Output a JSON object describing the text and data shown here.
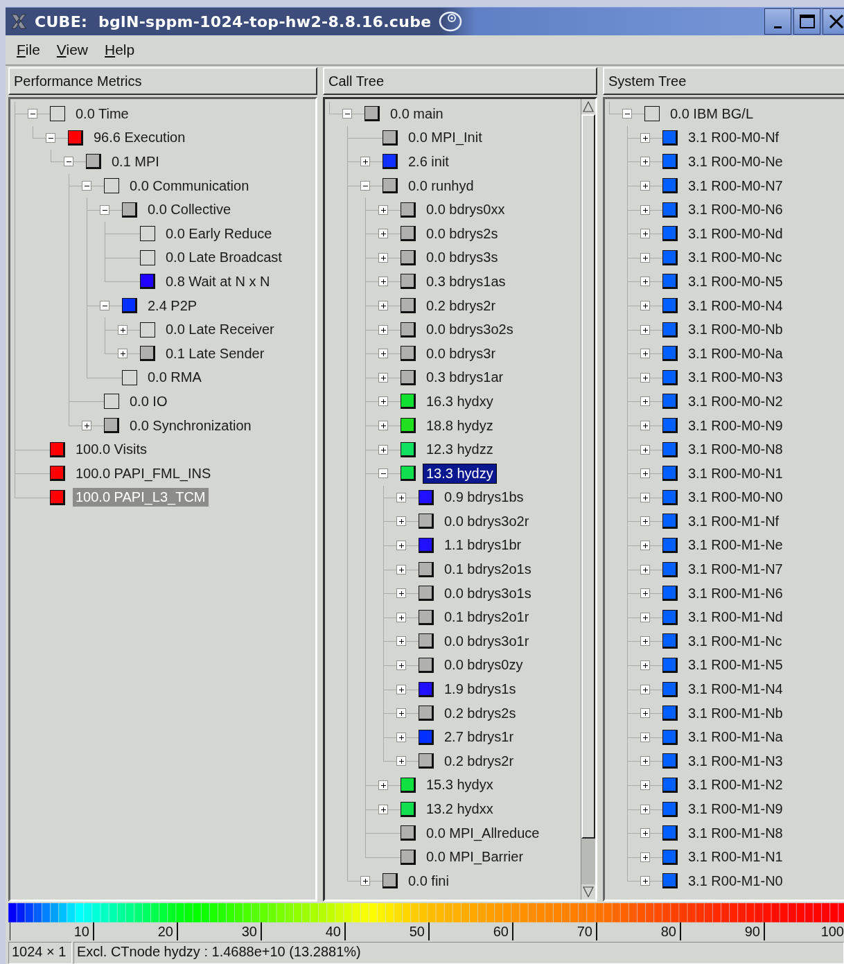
{
  "window": {
    "title": "CUBE:  bglN-sppm-1024-top-hw2-8.8.16.cube"
  },
  "menu": [
    {
      "label": "File"
    },
    {
      "label": "View"
    },
    {
      "label": "Help"
    }
  ],
  "panels": [
    {
      "title": "Performance Metrics",
      "focused": false,
      "tree": [
        {
          "label": "0.0 Time",
          "expanded": true,
          "selected": false,
          "children": [
            {
              "label": "96.6 Execution",
              "color": "#ff0000",
              "expanded": true,
              "selected": false,
              "children": [
                {
                  "label": "0.1 MPI",
                  "color": "#b0b0ae",
                  "expanded": true,
                  "selected": false,
                  "children": [
                    {
                      "label": "0.0 Communication",
                      "expanded": true,
                      "selected": false,
                      "children": [
                        {
                          "label": "0.0 Collective",
                          "color": "#b0b0ae",
                          "expanded": true,
                          "selected": false,
                          "children": [
                            {
                              "label": "0.0 Early Reduce",
                              "selected": false
                            },
                            {
                              "label": "0.0 Late Broadcast",
                              "selected": false
                            },
                            {
                              "label": "0.8 Wait at N x N",
                              "color": "#2000ff",
                              "selected": false
                            }
                          ]
                        },
                        {
                          "label": "2.4 P2P",
                          "color": "#0030ff",
                          "expanded": true,
                          "selected": false,
                          "children": [
                            {
                              "label": "0.0 Late Receiver",
                              "expanded": false,
                              "selected": false
                            },
                            {
                              "label": "0.1 Late Sender",
                              "color": "#b0b0ae",
                              "expanded": false,
                              "selected": false
                            }
                          ]
                        },
                        {
                          "label": "0.0 RMA",
                          "selected": false
                        }
                      ]
                    },
                    {
                      "label": "0.0 IO",
                      "selected": false
                    },
                    {
                      "label": "0.0 Synchronization",
                      "color": "#b0b0ae",
                      "expanded": false,
                      "selected": false
                    }
                  ]
                }
              ]
            }
          ]
        },
        {
          "label": "100.0 Visits",
          "color": "#ff0000",
          "selected": false
        },
        {
          "label": "100.0 PAPI_FML_INS",
          "color": "#ff0000",
          "selected": false
        },
        {
          "label": "100.0 PAPI_L3_TCM",
          "color": "#ff0000",
          "selected": true
        }
      ]
    },
    {
      "title": "Call Tree",
      "focused": true,
      "scrollable": true,
      "tree": [
        {
          "label": "0.0 main",
          "color": "#b0b0ae",
          "expanded": true,
          "selected": false,
          "children": [
            {
              "label": "0.0 MPI_Init",
              "color": "#b0b0ae",
              "selected": false
            },
            {
              "label": "2.6 init",
              "color": "#1030ff",
              "expanded": false,
              "selected": false
            },
            {
              "label": "0.0 runhyd",
              "color": "#b0b0ae",
              "expanded": true,
              "selected": false,
              "children": [
                {
                  "label": "0.0 bdrys0xx",
                  "color": "#b0b0ae",
                  "expanded": false,
                  "selected": false
                },
                {
                  "label": "0.0 bdrys2s",
                  "color": "#b0b0ae",
                  "expanded": false,
                  "selected": false
                },
                {
                  "label": "0.0 bdrys3s",
                  "color": "#b0b0ae",
                  "expanded": false,
                  "selected": false
                },
                {
                  "label": "0.3 bdrys1as",
                  "color": "#b0b0ae",
                  "expanded": false,
                  "selected": false
                },
                {
                  "label": "0.2 bdrys2r",
                  "color": "#b0b0ae",
                  "expanded": false,
                  "selected": false
                },
                {
                  "label": "0.0 bdrys3o2s",
                  "color": "#b0b0ae",
                  "expanded": false,
                  "selected": false
                },
                {
                  "label": "0.0 bdrys3r",
                  "color": "#b0b0ae",
                  "expanded": false,
                  "selected": false
                },
                {
                  "label": "0.3 bdrys1ar",
                  "color": "#b0b0ae",
                  "expanded": false,
                  "selected": false
                },
                {
                  "label": "16.3 hydxy",
                  "color": "#10e030",
                  "expanded": false,
                  "selected": false
                },
                {
                  "label": "18.8 hydyz",
                  "color": "#20e020",
                  "expanded": false,
                  "selected": false
                },
                {
                  "label": "12.3 hydzz",
                  "color": "#10e060",
                  "expanded": false,
                  "selected": false
                },
                {
                  "label": "13.3 hydzy",
                  "color": "#10e050",
                  "expanded": true,
                  "selected": true,
                  "children": [
                    {
                      "label": "0.9 bdrys1bs",
                      "color": "#2010ff",
                      "expanded": false,
                      "selected": false
                    },
                    {
                      "label": "0.0 bdrys3o2r",
                      "color": "#b0b0ae",
                      "expanded": false,
                      "selected": false
                    },
                    {
                      "label": "1.1 bdrys1br",
                      "color": "#2010ff",
                      "expanded": false,
                      "selected": false
                    },
                    {
                      "label": "0.1 bdrys2o1s",
                      "color": "#b0b0ae",
                      "expanded": false,
                      "selected": false
                    },
                    {
                      "label": "0.0 bdrys3o1s",
                      "color": "#b0b0ae",
                      "expanded": false,
                      "selected": false
                    },
                    {
                      "label": "0.1 bdrys2o1r",
                      "color": "#b0b0ae",
                      "expanded": false,
                      "selected": false
                    },
                    {
                      "label": "0.0 bdrys3o1r",
                      "color": "#b0b0ae",
                      "expanded": false,
                      "selected": false
                    },
                    {
                      "label": "0.0 bdrys0zy",
                      "color": "#b0b0ae",
                      "expanded": false,
                      "selected": false
                    },
                    {
                      "label": "1.9 bdrys1s",
                      "color": "#2010ff",
                      "expanded": false,
                      "selected": false
                    },
                    {
                      "label": "0.2 bdrys2s",
                      "color": "#b0b0ae",
                      "expanded": false,
                      "selected": false
                    },
                    {
                      "label": "2.7 bdrys1r",
                      "color": "#0030ff",
                      "expanded": false,
                      "selected": false
                    },
                    {
                      "label": "0.2 bdrys2r",
                      "color": "#b0b0ae",
                      "expanded": false,
                      "selected": false
                    }
                  ]
                },
                {
                  "label": "15.3 hydyx",
                  "color": "#10e040",
                  "expanded": false,
                  "selected": false
                },
                {
                  "label": "13.2 hydxx",
                  "color": "#10e050",
                  "expanded": false,
                  "selected": false
                },
                {
                  "label": "0.0 MPI_Allreduce",
                  "color": "#b0b0ae",
                  "selected": false
                },
                {
                  "label": "0.0 MPI_Barrier",
                  "color": "#b0b0ae",
                  "selected": false
                }
              ]
            },
            {
              "label": "0.0 fini",
              "color": "#b0b0ae",
              "expanded": false,
              "selected": false
            }
          ]
        }
      ]
    },
    {
      "title": "System Tree",
      "focused": false,
      "tree": [
        {
          "label": "0.0 IBM BG/L",
          "expanded": true,
          "selected": false,
          "children": [
            {
              "label": "3.1 R00-M0-Nf",
              "color": "#0060ff",
              "expanded": false,
              "selected": false
            },
            {
              "label": "3.1 R00-M0-Ne",
              "color": "#0060ff",
              "expanded": false,
              "selected": false
            },
            {
              "label": "3.1 R00-M0-N7",
              "color": "#0060ff",
              "expanded": false,
              "selected": false
            },
            {
              "label": "3.1 R00-M0-N6",
              "color": "#0060ff",
              "expanded": false,
              "selected": false
            },
            {
              "label": "3.1 R00-M0-Nd",
              "color": "#0060ff",
              "expanded": false,
              "selected": false
            },
            {
              "label": "3.1 R00-M0-Nc",
              "color": "#0060ff",
              "expanded": false,
              "selected": false
            },
            {
              "label": "3.1 R00-M0-N5",
              "color": "#0060ff",
              "expanded": false,
              "selected": false
            },
            {
              "label": "3.1 R00-M0-N4",
              "color": "#0060ff",
              "expanded": false,
              "selected": false
            },
            {
              "label": "3.1 R00-M0-Nb",
              "color": "#0060ff",
              "expanded": false,
              "selected": false
            },
            {
              "label": "3.1 R00-M0-Na",
              "color": "#0060ff",
              "expanded": false,
              "selected": false
            },
            {
              "label": "3.1 R00-M0-N3",
              "color": "#0060ff",
              "expanded": false,
              "selected": false
            },
            {
              "label": "3.1 R00-M0-N2",
              "color": "#0060ff",
              "expanded": false,
              "selected": false
            },
            {
              "label": "3.1 R00-M0-N9",
              "color": "#0060ff",
              "expanded": false,
              "selected": false
            },
            {
              "label": "3.1 R00-M0-N8",
              "color": "#0060ff",
              "expanded": false,
              "selected": false
            },
            {
              "label": "3.1 R00-M0-N1",
              "color": "#0060ff",
              "expanded": false,
              "selected": false
            },
            {
              "label": "3.1 R00-M0-N0",
              "color": "#0060ff",
              "expanded": false,
              "selected": false
            },
            {
              "label": "3.1 R00-M1-Nf",
              "color": "#0060ff",
              "expanded": false,
              "selected": false
            },
            {
              "label": "3.1 R00-M1-Ne",
              "color": "#0060ff",
              "expanded": false,
              "selected": false
            },
            {
              "label": "3.1 R00-M1-N7",
              "color": "#0060ff",
              "expanded": false,
              "selected": false
            },
            {
              "label": "3.1 R00-M1-N6",
              "color": "#0060ff",
              "expanded": false,
              "selected": false
            },
            {
              "label": "3.1 R00-M1-Nd",
              "color": "#0060ff",
              "expanded": false,
              "selected": false
            },
            {
              "label": "3.1 R00-M1-Nc",
              "color": "#0060ff",
              "expanded": false,
              "selected": false
            },
            {
              "label": "3.1 R00-M1-N5",
              "color": "#0060ff",
              "expanded": false,
              "selected": false
            },
            {
              "label": "3.1 R00-M1-N4",
              "color": "#0060ff",
              "expanded": false,
              "selected": false
            },
            {
              "label": "3.1 R00-M1-Nb",
              "color": "#0060ff",
              "expanded": false,
              "selected": false
            },
            {
              "label": "3.1 R00-M1-Na",
              "color": "#0060ff",
              "expanded": false,
              "selected": false
            },
            {
              "label": "3.1 R00-M1-N3",
              "color": "#0060ff",
              "expanded": false,
              "selected": false
            },
            {
              "label": "3.1 R00-M1-N2",
              "color": "#0060ff",
              "expanded": false,
              "selected": false
            },
            {
              "label": "3.1 R00-M1-N9",
              "color": "#0060ff",
              "expanded": false,
              "selected": false
            },
            {
              "label": "3.1 R00-M1-N8",
              "color": "#0060ff",
              "expanded": false,
              "selected": false
            },
            {
              "label": "3.1 R00-M1-N1",
              "color": "#0060ff",
              "expanded": false,
              "selected": false
            },
            {
              "label": "3.1 R00-M1-N0",
              "color": "#0060ff",
              "expanded": false,
              "selected": false
            }
          ]
        }
      ]
    }
  ],
  "legend": {
    "ticks": [
      "10",
      "20",
      "30",
      "40",
      "50",
      "60",
      "70",
      "80",
      "90",
      "100"
    ]
  },
  "status_bar": [
    "1024 × 1",
    "Excl. CTnode hydzy : 1.4688e+10 (13.2881%)"
  ]
}
